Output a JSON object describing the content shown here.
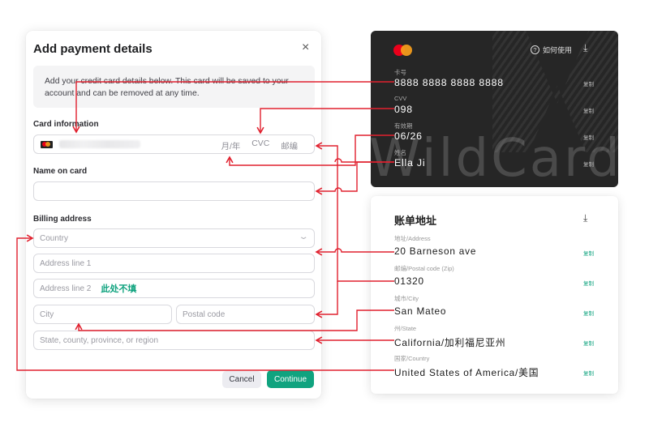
{
  "modal": {
    "title": "Add payment details",
    "close_icon": "×",
    "notice": "Add your credit card details below. This card will be saved to your account and can be removed at any time.",
    "card_info_label": "Card information",
    "card_brand_icon": "mastercard-icon",
    "card_expiry_placeholder": "月/年",
    "card_cvc_placeholder": "CVC",
    "card_zip_placeholder": "邮编",
    "name_label": "Name on card",
    "name_value": "",
    "billing_label": "Billing address",
    "country_placeholder": "Country",
    "address1_placeholder": "Address line 1",
    "address2_placeholder": "Address line 2",
    "address2_note": "此处不填",
    "city_placeholder": "City",
    "postal_placeholder": "Postal code",
    "state_placeholder": "State, county, province, or region",
    "cancel_label": "Cancel",
    "continue_label": "Continue"
  },
  "wildcard": {
    "watermark": "WildCard",
    "help_label": "如何使用",
    "help_icon": "?",
    "download_icon": "⤓",
    "fields": [
      {
        "key": "卡号",
        "value": "8888 8888 8888 8888",
        "copy": "复制"
      },
      {
        "key": "CVV",
        "value": "098",
        "copy": "复制"
      },
      {
        "key": "有效期",
        "value": "06/26",
        "copy": "复制"
      },
      {
        "key": "姓名",
        "value": "Ella Ji",
        "copy": "复制"
      }
    ]
  },
  "billing": {
    "title": "账单地址",
    "download_icon": "⤓",
    "fields": [
      {
        "key": "地址/Address",
        "value": "20 Barneson ave",
        "copy": "复制"
      },
      {
        "key": "邮编/Postal code (Zip)",
        "value": "01320",
        "copy": "复制"
      },
      {
        "key": "城市/City",
        "value": "San Mateo",
        "copy": "复制"
      },
      {
        "key": "州/State",
        "value": "California/加利福尼亚州",
        "copy": "复制"
      },
      {
        "key": "国家/Country",
        "value": "United States of America/美国",
        "copy": "复制"
      }
    ]
  },
  "colors": {
    "accent": "#10a37f",
    "arrow": "#e0202e",
    "card_bg": "#262626"
  }
}
